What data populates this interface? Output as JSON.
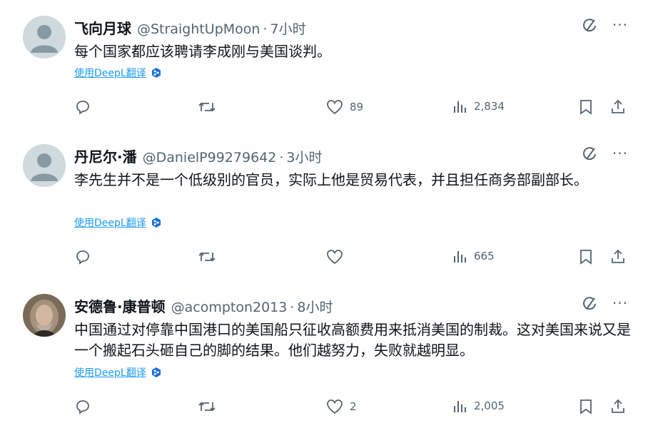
{
  "tweets": [
    {
      "name": "飞向月球",
      "handle": "@StraightUpMoon",
      "time": "7小时",
      "text": "每个国家都应该聘请李成刚与美国谈判。",
      "translate": "使用DeepL翻译",
      "likes": "89",
      "views": "2,834",
      "avatar": "default-avatar-icon"
    },
    {
      "name": "丹尼尔·潘",
      "handle": "@DanielP99279642",
      "time": "3小时",
      "text": "李先生并不是一个低级别的官员，实际上他是贸易代表，并且担任商务部副部长。",
      "translate": "使用DeepL翻译",
      "likes": "",
      "views": "665",
      "avatar": "default-avatar-icon"
    },
    {
      "name": "安德鲁·康普顿",
      "handle": "@acompton2013",
      "time": "8小时",
      "text": "中国通过对停靠中国港口的美国船只征收高额费用来抵消美国的制裁。这对美国来说又是一个搬起石头砸自己的脚的结果。他们越努力，失败就越明显。",
      "translate": "使用DeepL翻译",
      "likes": "2",
      "views": "2,005",
      "avatar": "photo-avatar"
    }
  ],
  "dot": "·",
  "more": "···",
  "colors": {
    "text": "#0f1419",
    "secondary": "#536471",
    "accent": "#1d9bf0"
  }
}
